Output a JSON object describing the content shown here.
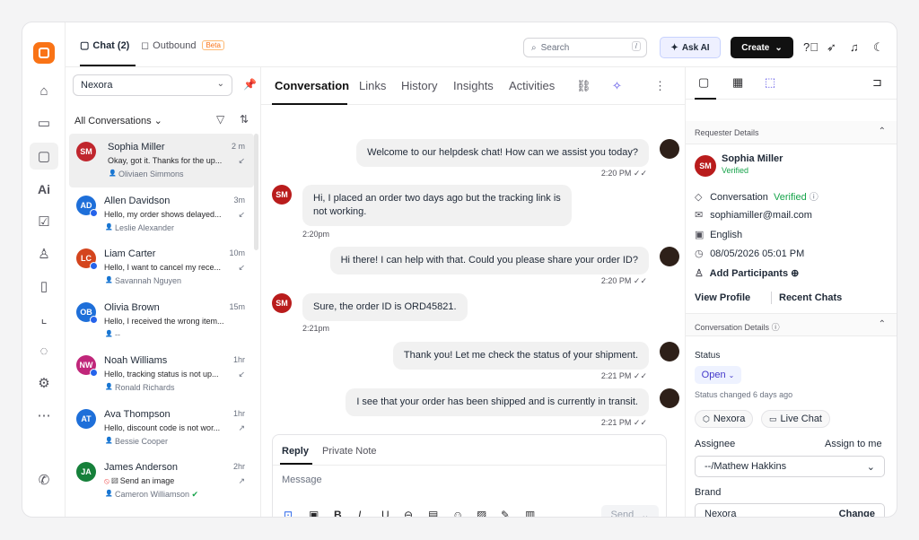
{
  "header": {
    "chat_tab": "Chat (2)",
    "outbound_tab": "Outbound",
    "beta": "Beta",
    "search_placeholder": "Search",
    "search_shortcut": "/",
    "ask_ai": "Ask AI",
    "create": "Create"
  },
  "left": {
    "inbox": "Nexora",
    "filter": "All Conversations",
    "conversations": [
      {
        "initials": "SM",
        "color": "#c0262d",
        "name": "Sophia Miller",
        "time": "2 m",
        "message": "Okay, got it. Thanks for the up...",
        "agent": "Oliviaen Simmons",
        "arrow": "↙",
        "fb": false,
        "selected": true
      },
      {
        "initials": "AD",
        "color": "#1e6fd9",
        "name": "Allen Davidson",
        "time": "3m",
        "message": "Hello, my order shows delayed...",
        "agent": "Leslie Alexander",
        "arrow": "↙",
        "fb": true
      },
      {
        "initials": "LC",
        "color": "#d4451e",
        "name": "Liam Carter",
        "time": "10m",
        "message": "Hello, I want to cancel my rece...",
        "agent": "Savannah Nguyen",
        "arrow": "↙",
        "fb": true
      },
      {
        "initials": "OB",
        "color": "#1e6fd9",
        "name": "Olivia Brown",
        "time": "15m",
        "message": "Hello, I received the wrong item...",
        "agent": "--",
        "arrow": "",
        "fb": true
      },
      {
        "initials": "NW",
        "color": "#c0267a",
        "name": "Noah Williams",
        "time": "1hr",
        "message": "Hello, tracking status is not up...",
        "agent": "Ronald Richards",
        "arrow": "↙",
        "fb": true
      },
      {
        "initials": "AT",
        "color": "#1e6fd9",
        "name": "Ava Thompson",
        "time": "1hr",
        "message": "Hello, discount code is not wor...",
        "agent": "Bessie Cooper",
        "arrow": "↗",
        "fb": false
      },
      {
        "initials": "JA",
        "color": "#16803a",
        "name": "James Anderson",
        "time": "2hr",
        "message": "Send an image",
        "agent": "Cameron Williamson",
        "arrow": "↗",
        "fb": false
      }
    ]
  },
  "middle": {
    "tabs": [
      "Conversation",
      "Links",
      "History",
      "Insights",
      "Activities"
    ],
    "messages": [
      {
        "from": "agent",
        "text": "Welcome to our helpdesk chat! How can we assist you today?",
        "time": "2:20 PM"
      },
      {
        "from": "customer",
        "text": "Hi, I placed an order two days ago but the tracking link is not working.",
        "time": "2:20pm"
      },
      {
        "from": "agent",
        "text": "Hi there! I can help with that. Could you please share your order ID?",
        "time": "2:20 PM"
      },
      {
        "from": "customer",
        "text": "Sure, the order ID is ORD45821.",
        "time": "2:21pm"
      },
      {
        "from": "agent",
        "text": "Thank you! Let me check the status of your shipment.",
        "time": "2:21 PM"
      },
      {
        "from": "agent",
        "text": "I see that your order has been shipped and is currently in transit.",
        "time": "2:21 PM"
      }
    ],
    "customer_initials": "SM",
    "composer": {
      "reply_tab": "Reply",
      "note_tab": "Private Note",
      "placeholder": "Message",
      "send": "Send"
    }
  },
  "right": {
    "requester_title": "Requester Details",
    "name": "Sophia Miller",
    "initials": "SM",
    "verified": "Verified",
    "channel": "Conversation",
    "channel_status": "Verified",
    "email": "sophiamiller@mail.com",
    "language": "English",
    "datetime": "08/05/2026 05:01 PM",
    "add_participants": "Add Participants",
    "view_profile": "View Profile",
    "recent_chats": "Recent Chats",
    "conv_details_title": "Conversation Details",
    "status_label": "Status",
    "status_value": "Open",
    "status_changed": "Status changed 6 days ago",
    "chip_brand": "Nexora",
    "chip_channel": "Live Chat",
    "assignee_label": "Assignee",
    "assign_to_me": "Assign to me",
    "assignee_value": "--/Mathew Hakkins",
    "brand_label": "Brand",
    "brand_value": "Nexora",
    "change": "Change"
  }
}
